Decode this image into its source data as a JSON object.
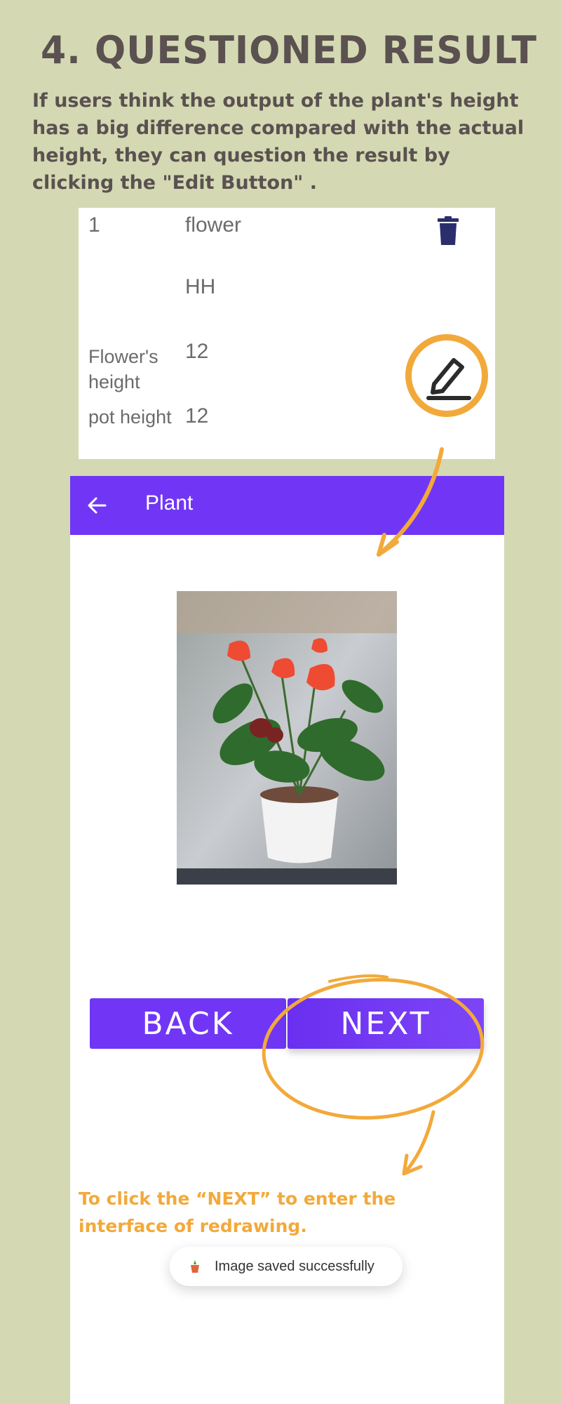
{
  "header": {
    "title": "4. QUESTIONED RESULT",
    "description": "If users think the output of the plant's height has a big difference compared with the actual height, they can question the result by clicking the \"Edit Button\" ."
  },
  "record": {
    "index": "1",
    "name": "flower",
    "code": "HH",
    "flower_height_label": "Flower's height",
    "flower_height_value": "12",
    "pot_height_label": "pot height",
    "pot_height_value": "12"
  },
  "app": {
    "title": "Plant",
    "back_label": "BACK",
    "next_label": "NEXT",
    "toast": "Image saved successfully"
  },
  "instruction": "To click the “NEXT”  to enter the interface of redrawing.",
  "colors": {
    "background": "#d4d9b3",
    "accent_purple": "#7136f5",
    "annotation_orange": "#f2a93b",
    "heading_text": "#5a5150",
    "trash_navy": "#2a2f6b"
  },
  "icons": [
    "trash-icon",
    "edit-pencil-icon",
    "back-arrow-icon",
    "toast-app-icon"
  ]
}
